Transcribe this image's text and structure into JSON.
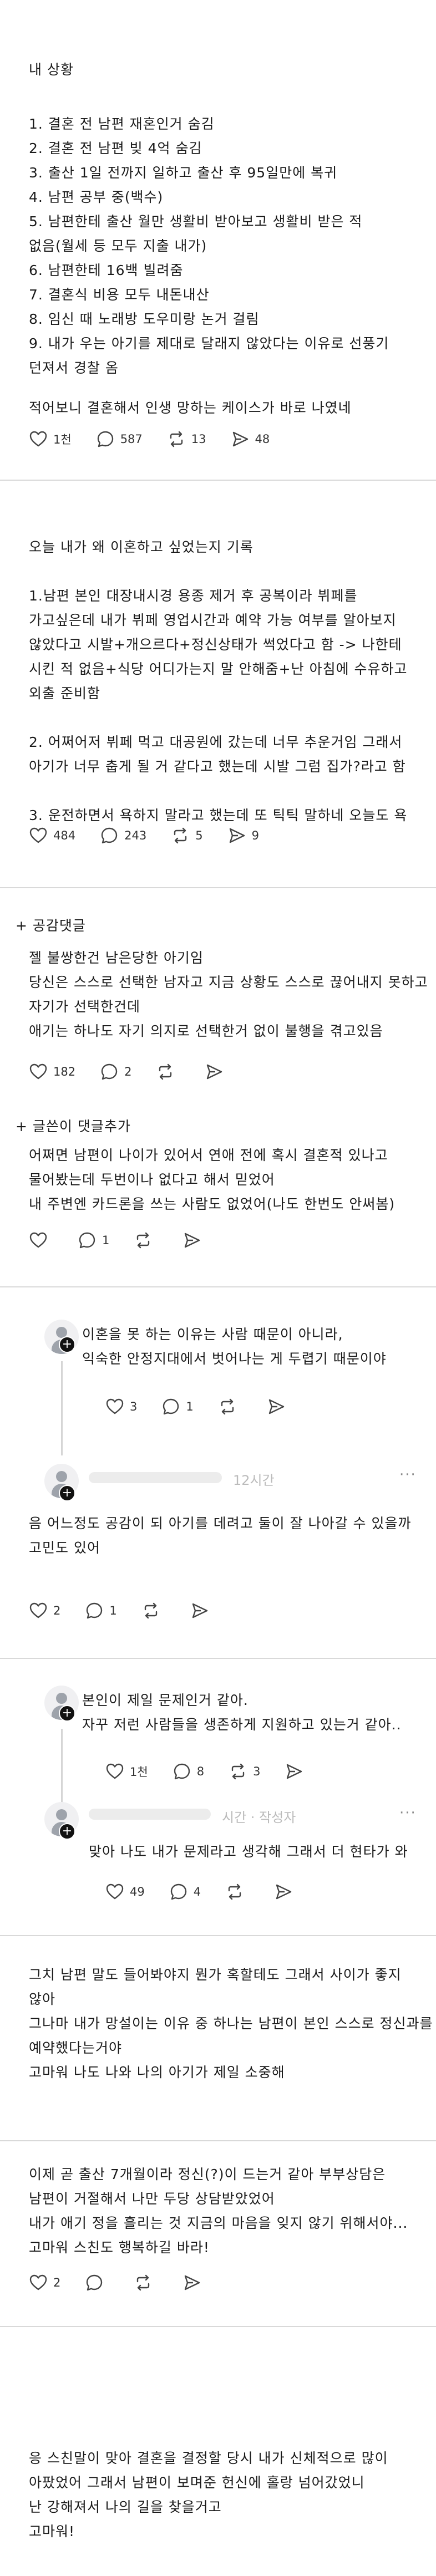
{
  "post": {
    "heading": "내 상황",
    "lines": [
      "1. 결혼 전 남편 재혼인거 숨김",
      "2. 결혼 전 남편 빚 4억 숨김",
      "3. 출산 1일 전까지 일하고 출산 후 95일만에 복귀",
      "4. 남편 공부 중(백수)",
      "5. 남편한테 출산 월만 생활비 받아보고 생활비 받은 적",
      "없음(월세 등 모두 지출 내가)",
      "6. 남편한테 16백 빌려줌",
      "7. 결혼식 비용 모두 내돈내산",
      "8. 임신 때 노래방 도우미랑 논거 걸림",
      "9. 내가 우는 아기를 제대로 달래지 않았다는 이유로 선풍기",
      "던져서 경찰 옴"
    ],
    "closing": "적어보니 결혼해서 인생 망하는 케이스가 바로 나였네",
    "stats": {
      "likes": "1천",
      "comments": "587",
      "reposts": "13",
      "shares": "48"
    }
  },
  "post2": {
    "lines": [
      "오늘 내가 왜 이혼하고 싶었는지 기록",
      "",
      "1.남편 본인 대장내시경 용종 제거 후 공복이라 뷔페를",
      "가고싶은데 내가 뷔페 영업시간과 예약 가능 여부를 알아보지",
      "않았다고 시발+개으르다+정신상태가 썩었다고 함 -> 나한테",
      "시킨 적 없음+식당 어디가는지 말 안해줌+난 아침에 수유하고",
      "외출 준비함",
      "",
      "2. 어쩌어저 뷔페 먹고 대공원에 갔는데 너무 추운거임 그래서",
      "아기가 너무 춥게 될 거 같다고 했는데 시발 그럼 집가?라고 함",
      "",
      "3. 운전하면서 욕하지 말라고 했는데 또 틱틱 말하네 오늘도 욕"
    ],
    "stats": {
      "likes": "484",
      "comments": "243",
      "reposts": "5",
      "shares": "9"
    }
  },
  "sympathy": {
    "title": "+ 공감댓글",
    "lines": [
      "젤 불쌍한건 남은당한 아기임",
      "당신은 스스로 선택한 남자고 지금 상황도 스스로 끊어내지 못하고",
      "자기가 선택한건데",
      "애기는 하나도 자기 의지로 선택한거 없이 불행을 겪고있음"
    ],
    "stats": {
      "likes": "182",
      "comments": "2",
      "reposts": "",
      "shares": ""
    }
  },
  "author_added": {
    "title": "+ 글쓴이 댓글추가",
    "lines": [
      "어쩌면 남편이 나이가 있어서 연애 전에 혹시 결혼적 있나고",
      "물어봤는데 두번이나 없다고 해서 믿었어",
      "내 주변엔 카드론을 쓰는 사람도 없었어(나도 한번도 안써봄)"
    ],
    "stats": {
      "likes": "",
      "comments": "1",
      "reposts": "",
      "shares": ""
    }
  },
  "reply1": {
    "lines": [
      "이혼을 못 하는 이유는 사람 때문이 아니라,",
      "익숙한 안정지대에서 벗어나는 게 두렵기 때문이야"
    ],
    "stats": {
      "likes": "3",
      "comments": "1",
      "reposts": "",
      "shares": ""
    }
  },
  "reply2": {
    "time": "12시간",
    "more": "···",
    "lines": [
      "음 어느정도 공감이 되 아기를 데려고 둘이 잘 나아갈 수 있을까",
      "고민도 있어"
    ],
    "stats": {
      "likes": "2",
      "comments": "1",
      "reposts": "",
      "shares": ""
    }
  },
  "reply3": {
    "lines": [
      "본인이 제일 문제인거 같아.",
      "자꾸 저런 사람들을 생존하게 지원하고 있는거 같아.."
    ],
    "stats": {
      "likes": "1천",
      "comments": "8",
      "reposts": "3",
      "shares": ""
    }
  },
  "reply4": {
    "time": "시간 · 작성자",
    "more": "···",
    "lines": [
      "맞아 나도 내가 문제라고 생각해 그래서 더 현타가 와"
    ],
    "stats": {
      "likes": "49",
      "comments": "4",
      "reposts": "",
      "shares": ""
    }
  },
  "reply5": {
    "lines": [
      "그치 남편 말도 들어봐야지 뭔가 혹할테도 그래서 사이가 좋지",
      "않아",
      "그나마 내가 망설이는 이유 중 하나는 남편이 본인 스스로 정신과를",
      "예약했다는거야",
      "고마워 나도 나와 나의 아기가 제일 소중해"
    ],
    "stats": {
      "likes": "",
      "comments": "",
      "reposts": "",
      "shares": ""
    }
  },
  "reply6": {
    "lines": [
      "이제 곧 출산 7개월이라 정신(?)이 드는거 같아 부부상담은",
      "남편이 거절해서 나만 두당 상담받았었어",
      "내가 애기 정을 흘리는 것 지금의 마음을 잊지 않기 위해서야...",
      "고마워 스친도 행복하길 바라!"
    ],
    "stats": {
      "likes": "2",
      "comments": "",
      "reposts": "",
      "shares": ""
    }
  },
  "reply7": {
    "lines": [
      "응 스친말이 맞아 결혼을 결정할 당시 내가 신체적으로 많이",
      "아팠었어 그래서 남편이 보며준 헌신에 홀랑 넘어갔었니",
      "난 강해져서 나의 길을 찾을거고",
      "고마워!"
    ]
  },
  "icons": [
    "heart-icon",
    "comment-icon",
    "repost-icon",
    "share-icon",
    "avatar-icon",
    "follow-plus-icon",
    "more-icon"
  ],
  "colors": {
    "text": "#1a1a1a",
    "meta": "#333333",
    "divider": "#d9d9d9",
    "thread": "#d5d5d5"
  }
}
